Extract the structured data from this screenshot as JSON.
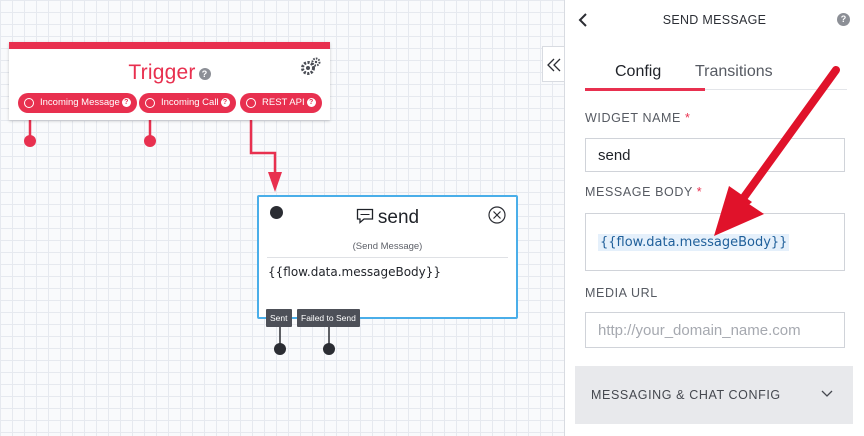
{
  "trigger": {
    "title": "Trigger",
    "help": "?",
    "pills": [
      {
        "label": "Incoming Message",
        "help": "?"
      },
      {
        "label": "Incoming Call",
        "help": "?"
      },
      {
        "label": "REST API",
        "help": "?"
      }
    ]
  },
  "send_widget": {
    "title": "send",
    "subtitle": "(Send Message)",
    "body": "{{flow.data.messageBody}}",
    "transitions": [
      "Sent",
      "Failed to Send"
    ]
  },
  "panel": {
    "back_icon": "chevron-left-icon",
    "title": "SEND MESSAGE",
    "help": "?",
    "collapse_icon": "double-chevron-left-icon",
    "tabs": [
      "Config",
      "Transitions"
    ],
    "active_tab": "Config",
    "fields": {
      "widget_name_label": "WIDGET NAME",
      "widget_name_value": "send",
      "message_body_label": "MESSAGE BODY",
      "message_body_value": "{{flow.data.messageBody}}",
      "media_url_label": "MEDIA URL",
      "media_url_placeholder": "http://your_domain_name.com",
      "required_mark": "*"
    },
    "accordion": {
      "label": "MESSAGING & CHAT CONFIG",
      "icon": "chevron-down-icon"
    }
  },
  "colors": {
    "brand_red": "#e8304f",
    "selection_blue": "#4aaee9",
    "annotation_red": "#e0122a"
  }
}
